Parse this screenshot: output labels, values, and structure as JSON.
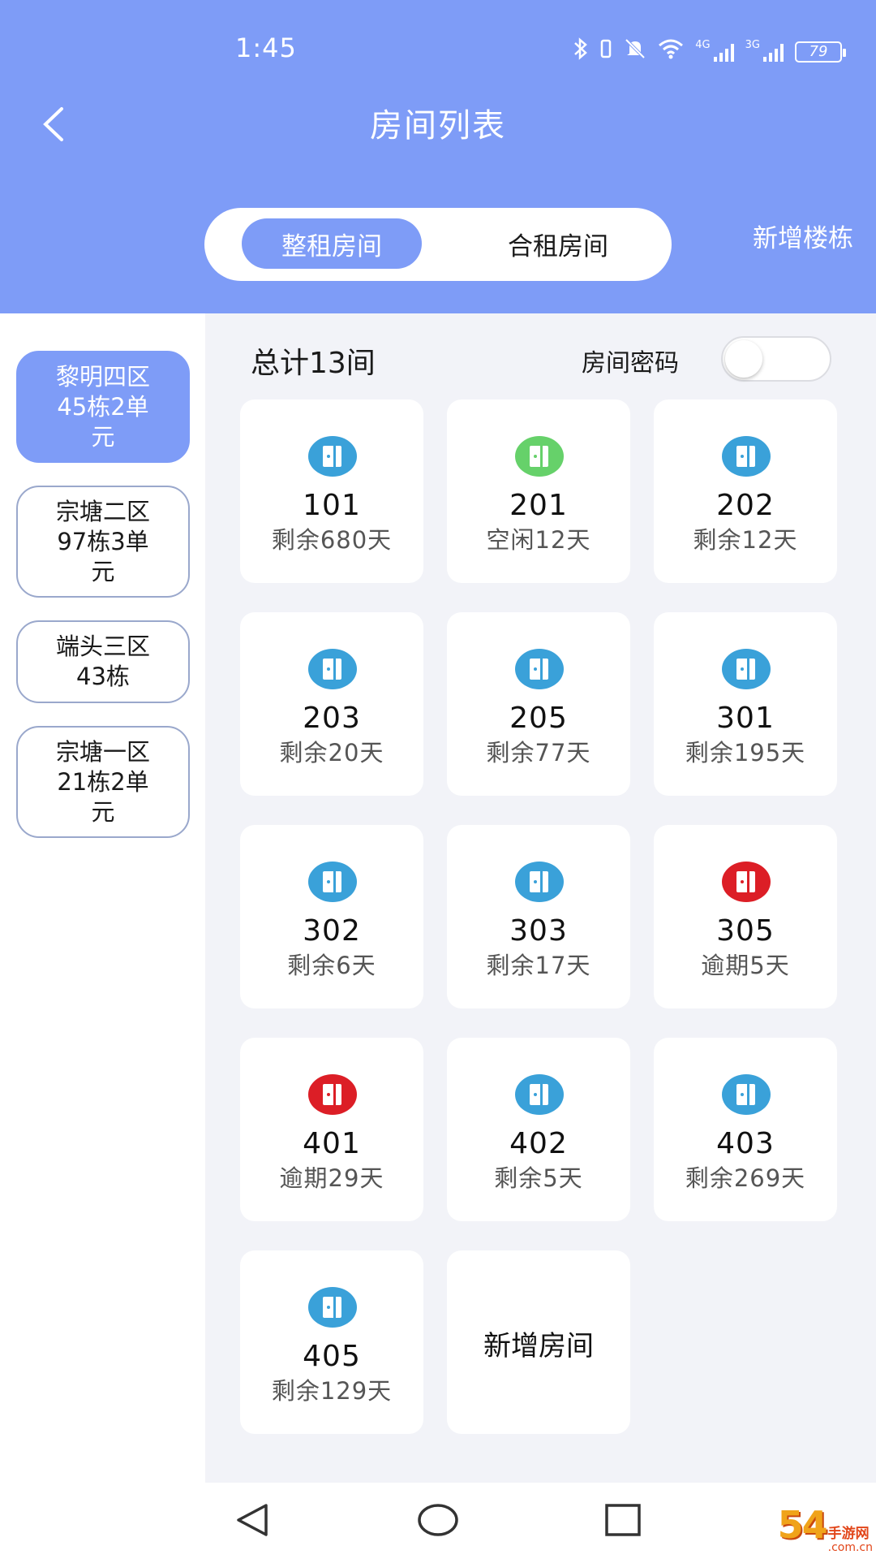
{
  "status_bar": {
    "time": "1:45",
    "battery": "79",
    "net1": "4G",
    "net2": "3G"
  },
  "header": {
    "title": "房间列表",
    "tabs": [
      {
        "label": "整租房间",
        "active": true
      },
      {
        "label": "合租房间",
        "active": false
      }
    ],
    "new_building": "新增楼栋"
  },
  "buildings": [
    {
      "label": "黎明四区45栋2单元",
      "lines": [
        "黎明四区",
        "45栋2单",
        "元"
      ],
      "active": true
    },
    {
      "label": "宗塘二区97栋3单元",
      "lines": [
        "宗塘二区",
        "97栋3单",
        "元"
      ],
      "active": false
    },
    {
      "label": "端头三区43栋",
      "lines": [
        "端头三区",
        "43栋"
      ],
      "active": false
    },
    {
      "label": "宗塘一区21栋2单元",
      "lines": [
        "宗塘一区",
        "21栋2单",
        "元"
      ],
      "active": false
    }
  ],
  "summary": {
    "total": "总计13间",
    "password_label": "房间密码",
    "password_toggle_on": false
  },
  "status_colors": {
    "normal": "#3aa1d9",
    "vacant": "#66d16a",
    "overdue": "#dc1e26"
  },
  "rooms": [
    {
      "number": "101",
      "status": "剩余680天",
      "state": "normal"
    },
    {
      "number": "201",
      "status": "空闲12天",
      "state": "vacant"
    },
    {
      "number": "202",
      "status": "剩余12天",
      "state": "normal"
    },
    {
      "number": "203",
      "status": "剩余20天",
      "state": "normal"
    },
    {
      "number": "205",
      "status": "剩余77天",
      "state": "normal"
    },
    {
      "number": "301",
      "status": "剩余195天",
      "state": "normal"
    },
    {
      "number": "302",
      "status": "剩余6天",
      "state": "normal"
    },
    {
      "number": "303",
      "status": "剩余17天",
      "state": "normal"
    },
    {
      "number": "305",
      "status": "逾期5天",
      "state": "overdue"
    },
    {
      "number": "401",
      "status": "逾期29天",
      "state": "overdue"
    },
    {
      "number": "402",
      "status": "剩余5天",
      "state": "normal"
    },
    {
      "number": "403",
      "status": "剩余269天",
      "state": "normal"
    },
    {
      "number": "405",
      "status": "剩余129天",
      "state": "normal"
    }
  ],
  "add_room_label": "新增房间",
  "watermark": {
    "big": "54",
    "brand": "手游网",
    "domain": ".com.cn"
  }
}
